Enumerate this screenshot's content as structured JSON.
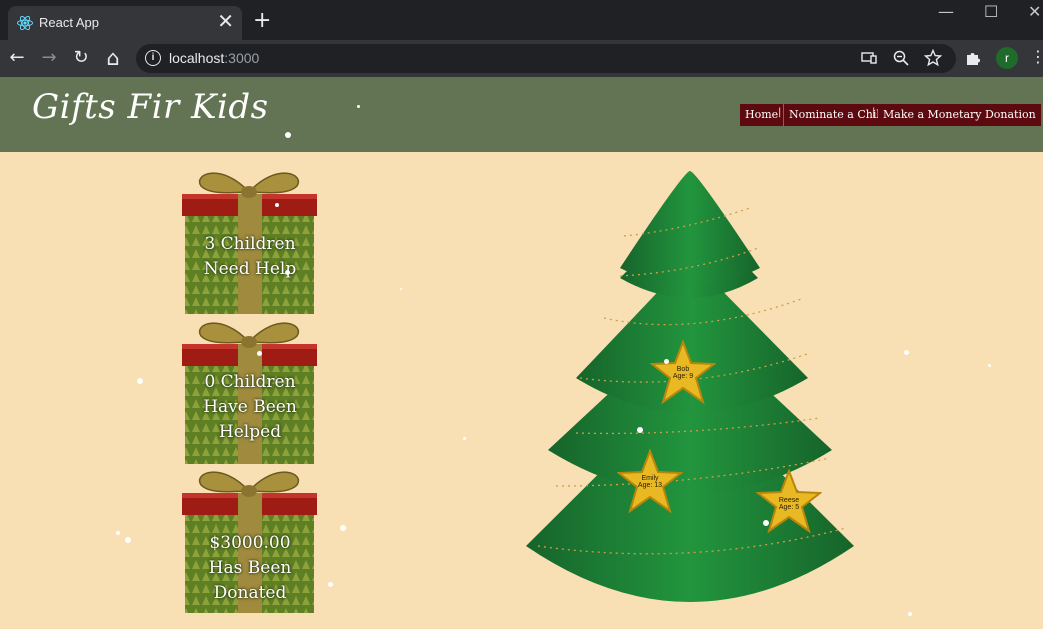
{
  "browser": {
    "tab_title": "React App",
    "tab_close": "✕",
    "new_tab": "+",
    "url_host": "localhost",
    "url_port": ":3000",
    "profile_initial": "r",
    "info_glyph": "i",
    "minimize_glyph": "—",
    "maximize_glyph": "☐",
    "close_glyph": "✕",
    "back_glyph": "←",
    "forward_glyph": "→",
    "reload_glyph": "↻",
    "home_glyph": "⌂",
    "kebab_glyph": "⋮"
  },
  "site": {
    "title": "Gifts Fir Kids",
    "nav": [
      {
        "label": "Home"
      },
      {
        "label": "Nominate a Child"
      },
      {
        "label": "Make a Monetary Donation"
      }
    ],
    "nav_separator": "|"
  },
  "stats": [
    {
      "text": "3 Children Need Help"
    },
    {
      "text": "0 Children Have Been Helped"
    },
    {
      "text": "$3000.00 Has Been Donated"
    }
  ],
  "children": [
    {
      "name": "Bob",
      "age": "Age: 9"
    },
    {
      "name": "Emily",
      "age": "Age: 13"
    },
    {
      "name": "Reese",
      "age": "Age: 5"
    }
  ],
  "colors": {
    "header_bg": "#627453",
    "nav_bg": "#5c0a0f",
    "page_bg": "#f9dfb4",
    "tree_green": "#1a7a32",
    "gift_green": "#5e7f23",
    "gift_red": "#9e1c14",
    "ribbon_gold": "#a08a3e",
    "star_gold": "#e8b923"
  }
}
